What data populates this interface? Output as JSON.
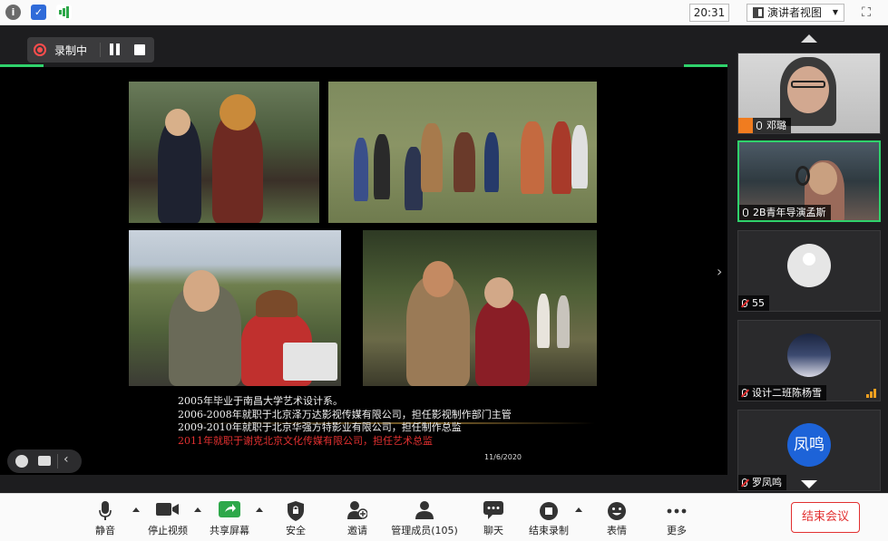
{
  "topbar": {
    "time": "20:31",
    "view_label": "演讲者视图"
  },
  "recording": {
    "label": "录制中"
  },
  "slide": {
    "lines": [
      "2005年毕业于南昌大学艺术设计系。",
      "2006-2008年就职于北京泽万达影视传媒有限公司，担任影视制作部门主管",
      "2009-2010年就职于北京华强方特影业有限公司，担任制作总监"
    ],
    "highlight_line": "2011年就职于谢克北京文化传媒有限公司，担任艺术总监",
    "date": "11/6/2020"
  },
  "gallery": {
    "participants": [
      {
        "name": "邓璐"
      },
      {
        "name": "2B青年导演孟斯"
      },
      {
        "name": "55"
      },
      {
        "name": "设计二班陈杨雪"
      },
      {
        "name": "罗凤鸣",
        "avatar_text": "凤鸣"
      }
    ]
  },
  "toolbar": {
    "mute": "静音",
    "stop_video": "停止视频",
    "share_screen": "共享屏幕",
    "security": "安全",
    "invite": "邀请",
    "participants": "管理成员(105)",
    "chat": "聊天",
    "stop_recording": "结束录制",
    "reactions": "表情",
    "more": "更多",
    "end_meeting": "结束会议"
  },
  "colors": {
    "accent_green": "#2fd26b",
    "end_red": "#e23030",
    "host_orange": "#f07c1f"
  }
}
